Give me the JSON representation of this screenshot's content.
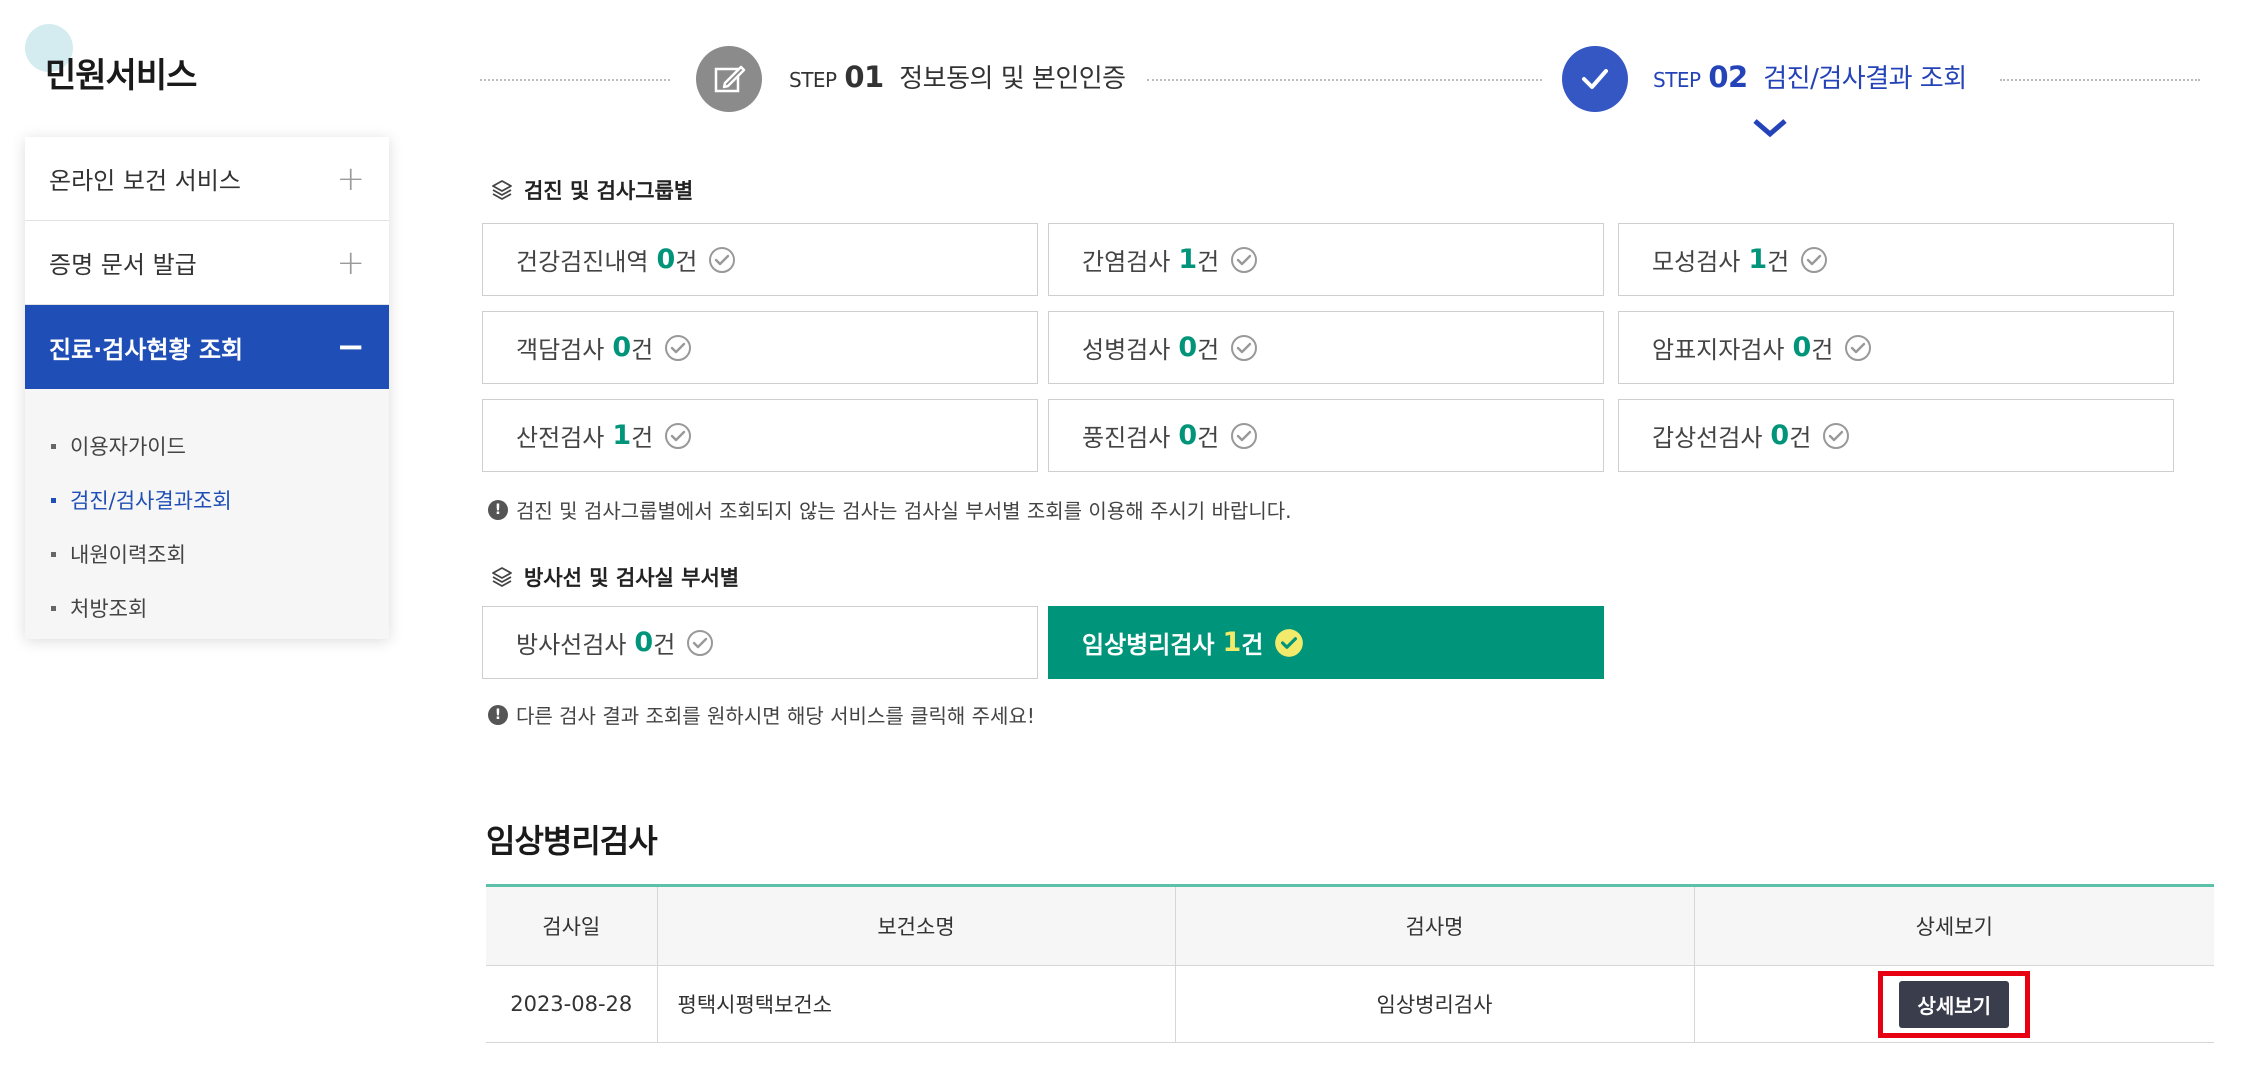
{
  "sidebar": {
    "title": "민원서비스",
    "menu": [
      {
        "label": "온라인 보건 서비스",
        "sign": "+"
      },
      {
        "label": "증명 문서 발급",
        "sign": "+"
      },
      {
        "label": "진료·검사현황 조회",
        "sign": "−"
      }
    ],
    "submenu": [
      {
        "label": "이용자가이드"
      },
      {
        "label": "검진/검사결과조회"
      },
      {
        "label": "내원이력조회"
      },
      {
        "label": "처방조회"
      }
    ]
  },
  "steps": [
    {
      "prefix": "STEP",
      "num": "01",
      "label": "정보동의 및 본인인증"
    },
    {
      "prefix": "STEP",
      "num": "02",
      "label": "검진/검사결과 조회"
    }
  ],
  "group_section": {
    "title": "검진 및 검사그룹별",
    "items": [
      {
        "label": "건강검진내역",
        "count": "0",
        "unit": "건"
      },
      {
        "label": "간염검사",
        "count": "1",
        "unit": "건"
      },
      {
        "label": "모성검사",
        "count": "1",
        "unit": "건"
      },
      {
        "label": "객담검사",
        "count": "0",
        "unit": "건"
      },
      {
        "label": "성병검사",
        "count": "0",
        "unit": "건"
      },
      {
        "label": "암표지자검사",
        "count": "0",
        "unit": "건"
      },
      {
        "label": "산전검사",
        "count": "1",
        "unit": "건"
      },
      {
        "label": "풍진검사",
        "count": "0",
        "unit": "건"
      },
      {
        "label": "갑상선검사",
        "count": "0",
        "unit": "건"
      }
    ],
    "notice": "검진 및 검사그룹별에서 조회되지 않는 검사는 검사실 부서별 조회를 이용해 주시기 바랍니다."
  },
  "dept_section": {
    "title": "방사선 및 검사실 부서별",
    "items": [
      {
        "label": "방사선검사",
        "count": "0",
        "unit": "건"
      },
      {
        "label": "임상병리검사",
        "count": "1",
        "unit": "건"
      }
    ],
    "notice": "다른 검사 결과 조회를 원하시면 해당 서비스를 클릭해 주세요!"
  },
  "result": {
    "title": "임상병리검사",
    "headers": [
      "검사일",
      "보건소명",
      "검사명",
      "상세보기"
    ],
    "rows": [
      {
        "date": "2023-08-28",
        "center": "평택시평택보건소",
        "test": "임상병리검사",
        "button": "상세보기"
      }
    ]
  },
  "colors": {
    "primary_blue": "#1f4fb6",
    "accent_green": "#00957a",
    "count_yellow": "#f1ea6b",
    "highlight_red": "#e60012"
  }
}
